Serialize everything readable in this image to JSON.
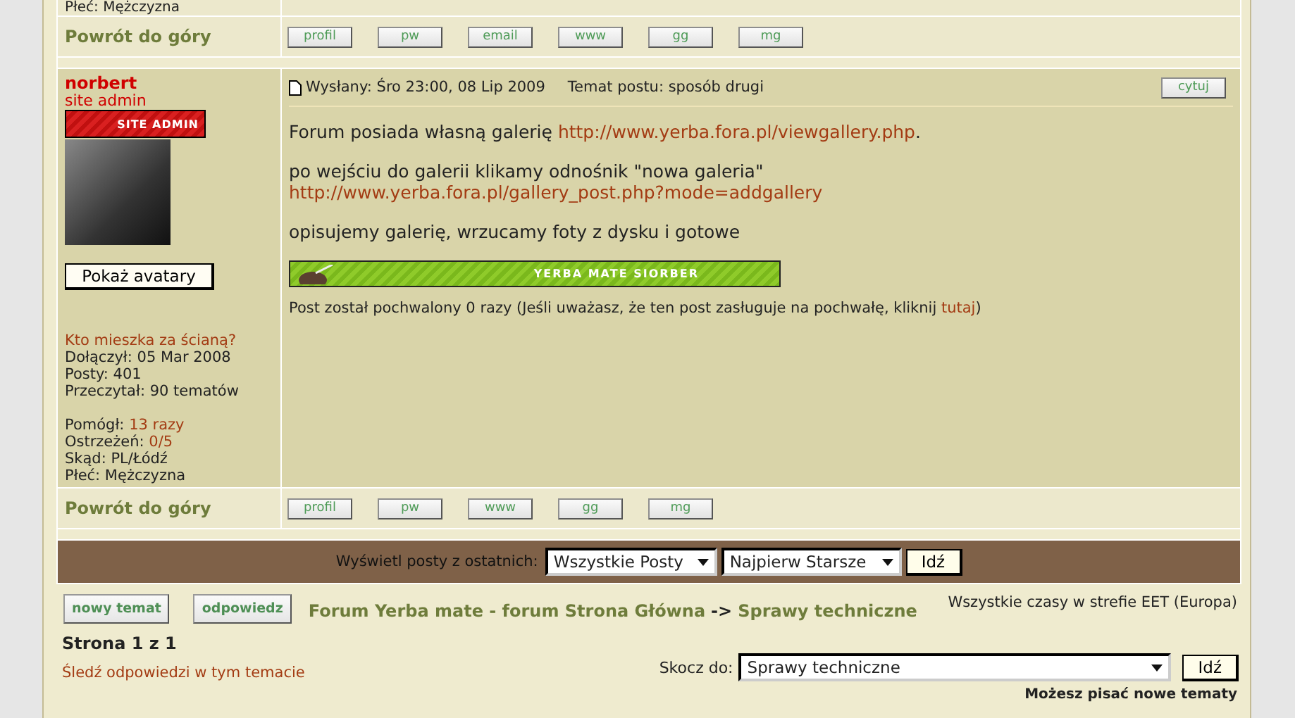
{
  "previous_post": {
    "poster_details_tail": "Płeć: Mężczyzna",
    "back_to_top": "Powrót do góry",
    "buttons": [
      "profil",
      "pw",
      "email",
      "www",
      "gg",
      "mg"
    ]
  },
  "post": {
    "author": "norbert",
    "rank": "site admin",
    "rank_badge": "SITE ADMIN",
    "show_avatars_button": "Pokaż avatary",
    "profile_groups": [
      [
        {
          "label": "Kto mieszka za ścianą?",
          "kind": "link"
        },
        {
          "label": "Dołączył: 05 Mar 2008",
          "kind": "text"
        },
        {
          "label": "Posty: 401",
          "kind": "text"
        },
        {
          "label": "Przeczytał: 90 tematów",
          "kind": "text"
        }
      ],
      [
        {
          "label": "Pomógł: ",
          "value": "13 razy",
          "kind": "text"
        },
        {
          "label": "Ostrzeżeń: ",
          "value": "0/5",
          "kind": "text"
        },
        {
          "label": "Skąd: PL/Łódź",
          "kind": "text"
        },
        {
          "label": "Płeć: Mężczyzna",
          "kind": "text"
        }
      ]
    ],
    "posted": "Wysłany: Śro 23:00, 08 Lip 2009",
    "subject": "Temat postu: sposób drugi",
    "quote_button": "cytuj",
    "body": [
      [
        {
          "kind": "text",
          "text": "Forum posiada własną galerię "
        },
        {
          "kind": "link",
          "text": "http://www.yerba.fora.pl/viewgallery.php"
        },
        {
          "kind": "text",
          "text": "."
        }
      ],
      [
        {
          "kind": "text",
          "text": "po wejściu do galerii klikamy odnośnik \"nowa galeria\""
        },
        {
          "kind": "break"
        },
        {
          "kind": "link",
          "text": "http://www.yerba.fora.pl/gallery_post.php?mode=addgallery"
        }
      ],
      [
        {
          "kind": "text",
          "text": "opisujemy galerię, wrzucamy foty z dysku i gotowe"
        }
      ]
    ],
    "signature_banner": "YERBA MATE SIORBER",
    "praise": {
      "text": "Post został pochwalony 0 razy (Jeśli uważasz, że ten post zasługuje na pochwałę, kliknij ",
      "link": "tutaj",
      "end": ")"
    },
    "back_to_top": "Powrót do góry",
    "buttons": [
      "profil",
      "pw",
      "www",
      "gg",
      "mg"
    ]
  },
  "display_bar": {
    "label": "Wyświetl posty z ostatnich:",
    "range": "Wszystkie Posty",
    "order": "Najpierw Starsze",
    "button": "Idź"
  },
  "actions": [
    "nowy temat",
    "odpowiedz"
  ],
  "breadcrumb": {
    "forum": "Forum Yerba mate - forum Strona Główna",
    "separator": "->",
    "category": "Sprawy techniczne"
  },
  "timezone": "Wszystkie czasy w strefie EET (Europa)",
  "pagination": "Strona 1 z 1",
  "watch_link": "Śledź odpowiedzi w tym temacie",
  "jump": {
    "label": "Skocz do:",
    "value": "Sprawy techniczne",
    "button": "Idź"
  },
  "permissions": "Możesz pisać nowe tematy"
}
